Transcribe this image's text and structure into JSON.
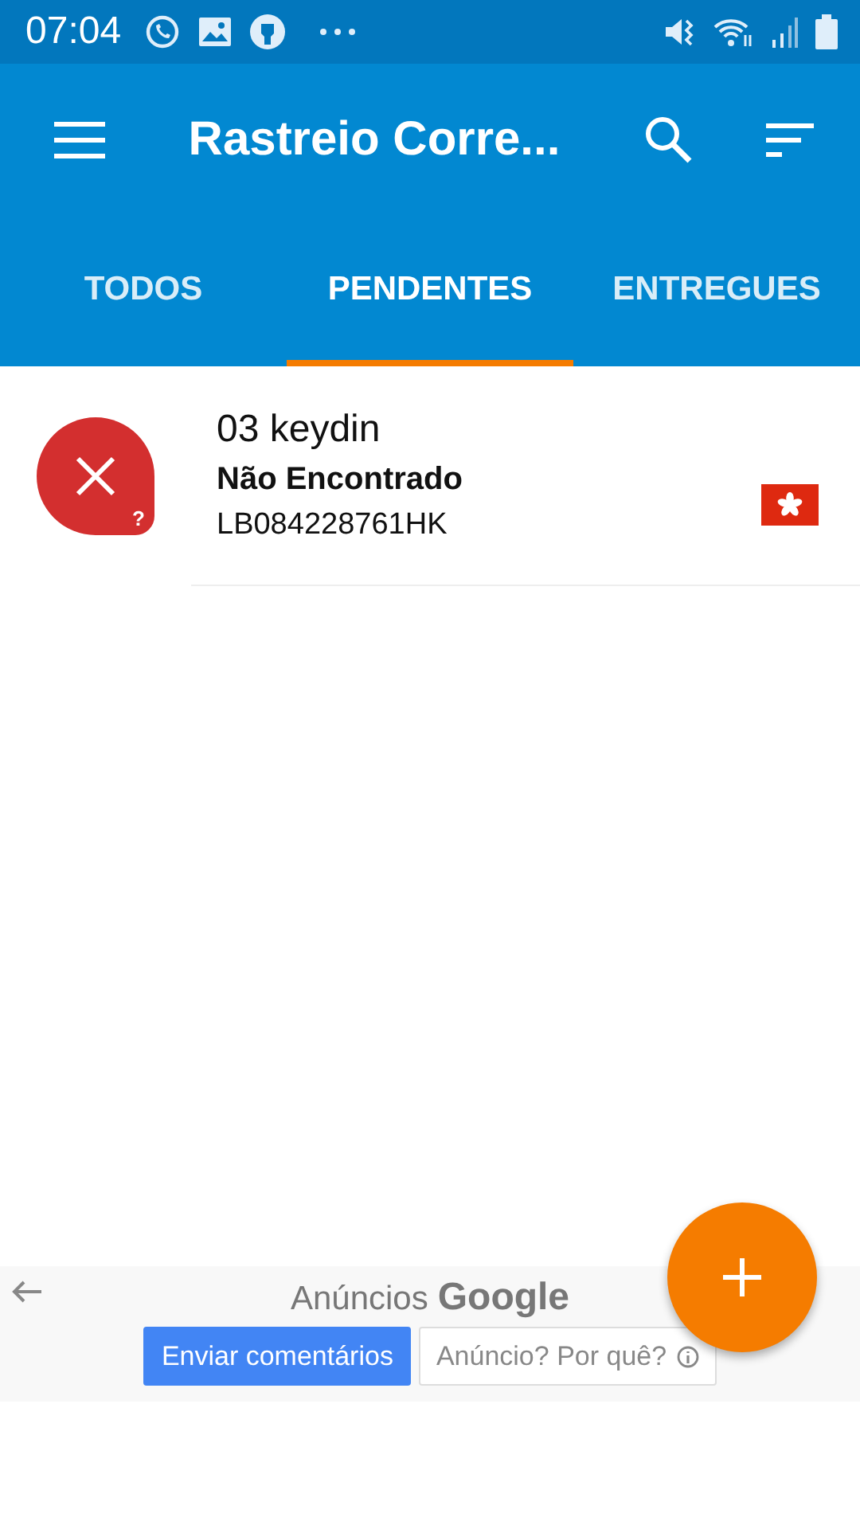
{
  "status_bar": {
    "time": "07:04"
  },
  "app_bar": {
    "title": "Rastreio Corre..."
  },
  "tabs": [
    {
      "label": "TODOS",
      "selected": false
    },
    {
      "label": "PENDENTES",
      "selected": true
    },
    {
      "label": "ENTREGUES",
      "selected": false
    }
  ],
  "packages": [
    {
      "name": "03 keydin",
      "status": "Não Encontrado",
      "code": "LB084228761HK",
      "badge": "?",
      "kind": "not_found"
    }
  ],
  "ad": {
    "label": "Anúncios",
    "brand": "Google",
    "feedback_button": "Enviar comentários",
    "why_button": "Anúncio? Por quê?"
  }
}
